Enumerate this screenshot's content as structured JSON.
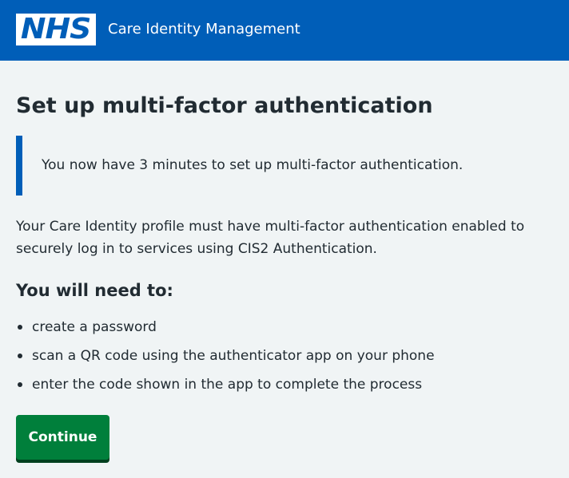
{
  "header": {
    "logo_text": "NHS",
    "service_name": "Care Identity Management",
    "background_color": "#005eb8"
  },
  "main": {
    "title": "Set up multi-factor authentication",
    "inset_text": "You now have 3 minutes to set up multi-factor authentication.",
    "intro": "Your Care Identity profile must have multi-factor authentication enabled to securely log in to services using CIS2 Authentication.",
    "subheading": "You will need to:",
    "needs": [
      "create a password",
      "scan a QR code using the authenticator app on your phone",
      "enter the code shown in the app to complete the process"
    ],
    "continue_label": "Continue",
    "button_color": "#007f3b"
  }
}
